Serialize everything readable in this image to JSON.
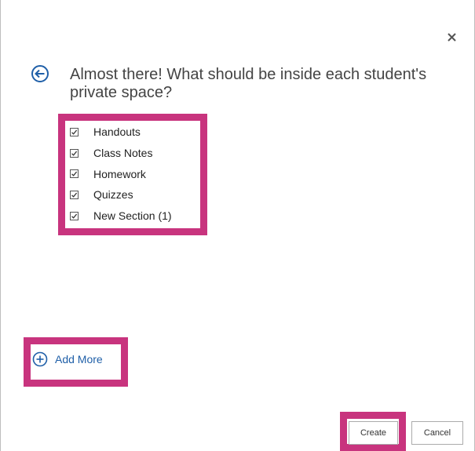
{
  "dialog": {
    "title": "Almost there! What should be inside each student's private space?",
    "close_icon": "close-icon",
    "back_icon": "back-arrow-icon"
  },
  "sections": [
    {
      "label": "Handouts",
      "checked": true
    },
    {
      "label": "Class Notes",
      "checked": true
    },
    {
      "label": "Homework",
      "checked": true
    },
    {
      "label": "Quizzes",
      "checked": true
    },
    {
      "label": "New Section (1)",
      "checked": true
    }
  ],
  "add_more": {
    "label": "Add More",
    "icon": "plus-circle-icon"
  },
  "footer": {
    "create_label": "Create",
    "cancel_label": "Cancel"
  },
  "colors": {
    "highlight": "#c8347e",
    "accent": "#1f5fa8",
    "title": "#444444"
  }
}
